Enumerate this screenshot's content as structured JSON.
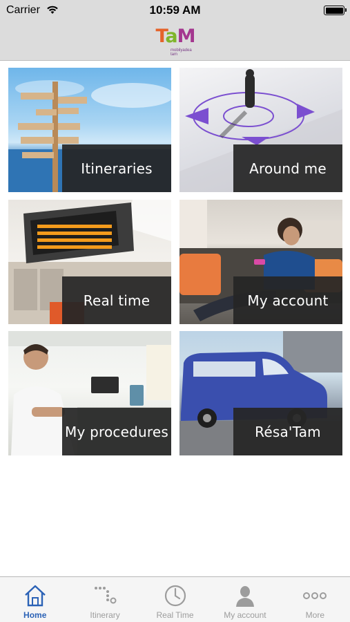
{
  "status_bar": {
    "carrier": "Carrier",
    "time": "10:59 AM"
  },
  "header": {
    "logo": {
      "letters": [
        "T",
        "a",
        "M"
      ],
      "tagline": "mobilyadea tam"
    }
  },
  "tiles": [
    {
      "label": "Itineraries"
    },
    {
      "label": "Around me"
    },
    {
      "label": "Real time"
    },
    {
      "label": "My account"
    },
    {
      "label": "My procedures"
    },
    {
      "label": "Résa'Tam"
    }
  ],
  "tab_bar": {
    "items": [
      {
        "label": "Home",
        "icon": "home-icon",
        "active": true
      },
      {
        "label": "Itinerary",
        "icon": "route-icon",
        "active": false
      },
      {
        "label": "Real Time",
        "icon": "clock-icon",
        "active": false
      },
      {
        "label": "My account",
        "icon": "user-icon",
        "active": false
      },
      {
        "label": "More",
        "icon": "more-icon",
        "active": false
      }
    ]
  },
  "colors": {
    "active_tab": "#2b62b6",
    "inactive_tab": "#9c9c9c",
    "tile_label_bg": "#262626",
    "bar_bg": "#dcdcdc"
  }
}
